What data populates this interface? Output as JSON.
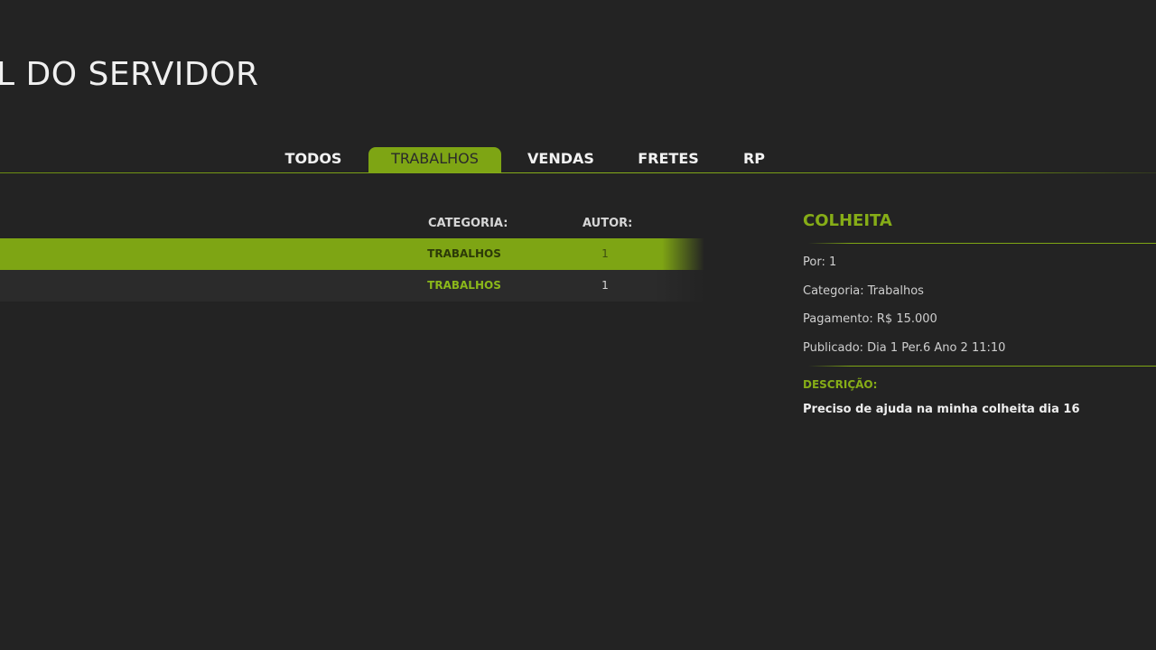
{
  "header": {
    "title": "L DO SERVIDOR"
  },
  "tabs": [
    {
      "label": "TODOS",
      "active": false
    },
    {
      "label": "TRABALHOS",
      "active": true
    },
    {
      "label": "VENDAS",
      "active": false
    },
    {
      "label": "FRETES",
      "active": false
    },
    {
      "label": "RP",
      "active": false
    }
  ],
  "list": {
    "columns": {
      "category": "CATEGORIA:",
      "author": "AUTOR:"
    },
    "rows": [
      {
        "category": "TRABALHOS",
        "author": "1",
        "selected": true
      },
      {
        "category": "TRABALHOS",
        "author": "1",
        "selected": false
      }
    ]
  },
  "detail": {
    "title": "COLHEITA",
    "by": "Por: 1",
    "category": "Categoria: Trabalhos",
    "payment": "Pagamento: R$ 15.000",
    "published": "Publicado: Dia 1 Per.6 Ano 2 11:10",
    "description_label": "DESCRIÇÃO:",
    "description": "Preciso de ajuda na minha colheita dia 16"
  },
  "colors": {
    "background": "#232323",
    "accent": "#7ea514",
    "accent_text": "#86ad17",
    "row_bg": "#2b2b2b"
  }
}
